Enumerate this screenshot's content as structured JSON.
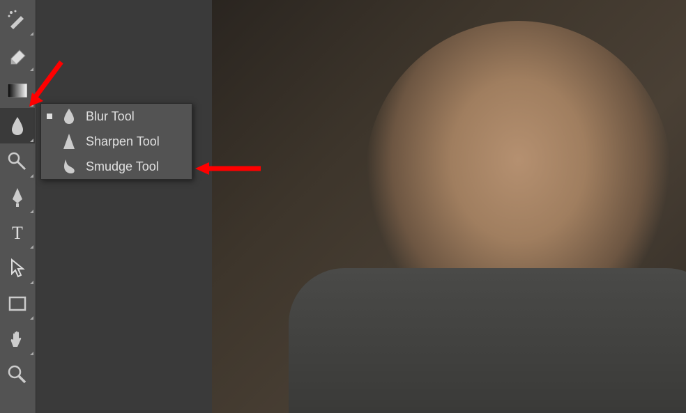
{
  "flyout": {
    "items": [
      {
        "label": "Blur Tool",
        "selected": true
      },
      {
        "label": "Sharpen Tool",
        "selected": false
      },
      {
        "label": "Smudge Tool",
        "selected": false
      }
    ]
  },
  "annotations": {
    "arrow_color": "#ff0000"
  }
}
